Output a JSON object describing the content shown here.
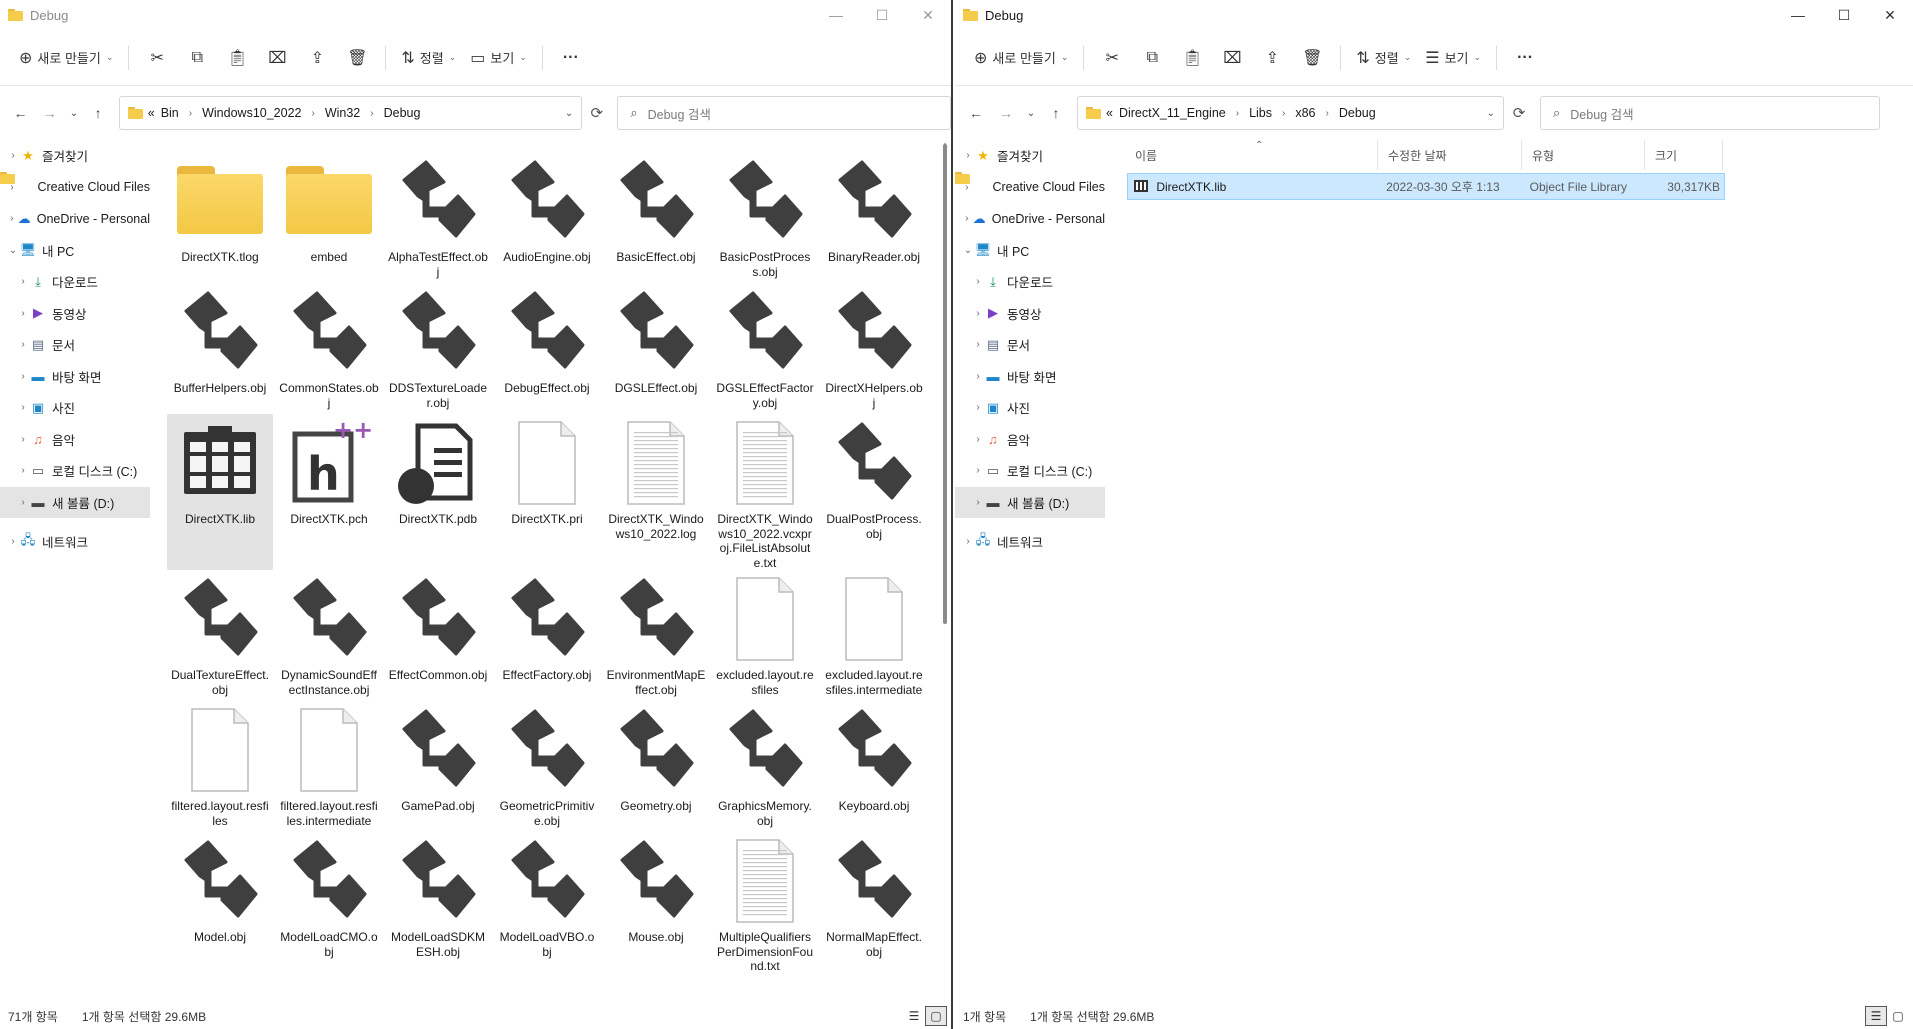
{
  "left_window": {
    "title": "Debug",
    "controls": {
      "minimize": "—",
      "maximize": "☐",
      "close": "✕"
    },
    "toolbar": {
      "new_label": "새로 만들기",
      "sort_label": "정렬",
      "view_label": "보기",
      "more_label": "···"
    },
    "address": {
      "overflow": "«",
      "crumbs": [
        "Bin",
        "Windows10_2022",
        "Win32",
        "Debug"
      ]
    },
    "search_placeholder": "Debug 검색",
    "nav": {
      "quick_access": "즐겨찾기",
      "creative_cloud": "Creative Cloud Files",
      "onedrive": "OneDrive - Personal",
      "this_pc": "내 PC",
      "downloads": "다운로드",
      "videos": "동영상",
      "documents": "문서",
      "desktop": "바탕 화면",
      "pictures": "사진",
      "music": "음악",
      "local_disk": "로컬 디스크 (C:)",
      "new_volume": "새 볼륨 (D:)",
      "network": "네트워크"
    },
    "files": [
      {
        "name": "DirectXTK.tlog",
        "icon": "folder-icon"
      },
      {
        "name": "embed",
        "icon": "folder-icon"
      },
      {
        "name": "AlphaTestEffect.obj",
        "icon": "obj-file-icon"
      },
      {
        "name": "AudioEngine.obj",
        "icon": "obj-file-icon"
      },
      {
        "name": "BasicEffect.obj",
        "icon": "obj-file-icon"
      },
      {
        "name": "BasicPostProcess.obj",
        "icon": "obj-file-icon"
      },
      {
        "name": "BinaryReader.obj",
        "icon": "obj-file-icon"
      },
      {
        "name": "BufferHelpers.obj",
        "icon": "obj-file-icon"
      },
      {
        "name": "CommonStates.obj",
        "icon": "obj-file-icon"
      },
      {
        "name": "DDSTextureLoader.obj",
        "icon": "obj-file-icon"
      },
      {
        "name": "DebugEffect.obj",
        "icon": "obj-file-icon"
      },
      {
        "name": "DGSLEffect.obj",
        "icon": "obj-file-icon"
      },
      {
        "name": "DGSLEffectFactory.obj",
        "icon": "obj-file-icon"
      },
      {
        "name": "DirectXHelpers.obj",
        "icon": "obj-file-icon"
      },
      {
        "name": "DirectXTK.lib",
        "icon": "lib-file-icon",
        "selected": true
      },
      {
        "name": "DirectXTK.pch",
        "icon": "pch-file-icon"
      },
      {
        "name": "DirectXTK.pdb",
        "icon": "pdb-file-icon"
      },
      {
        "name": "DirectXTK.pri",
        "icon": "blank-file-icon"
      },
      {
        "name": "DirectXTK_Windows10_2022.log",
        "icon": "text-file-icon"
      },
      {
        "name": "DirectXTK_Windows10_2022.vcxproj.FileListAbsolute.txt",
        "icon": "text-file-icon"
      },
      {
        "name": "DualPostProcess.obj",
        "icon": "obj-file-icon"
      },
      {
        "name": "DualTextureEffect.obj",
        "icon": "obj-file-icon"
      },
      {
        "name": "DynamicSoundEffectInstance.obj",
        "icon": "obj-file-icon"
      },
      {
        "name": "EffectCommon.obj",
        "icon": "obj-file-icon"
      },
      {
        "name": "EffectFactory.obj",
        "icon": "obj-file-icon"
      },
      {
        "name": "EnvironmentMapEffect.obj",
        "icon": "obj-file-icon"
      },
      {
        "name": "excluded.layout.resfiles",
        "icon": "blank-file-icon"
      },
      {
        "name": "excluded.layout.resfiles.intermediate",
        "icon": "blank-file-icon"
      },
      {
        "name": "filtered.layout.resfiles",
        "icon": "blank-file-icon"
      },
      {
        "name": "filtered.layout.resfiles.intermediate",
        "icon": "blank-file-icon"
      },
      {
        "name": "GamePad.obj",
        "icon": "obj-file-icon"
      },
      {
        "name": "GeometricPrimitive.obj",
        "icon": "obj-file-icon"
      },
      {
        "name": "Geometry.obj",
        "icon": "obj-file-icon"
      },
      {
        "name": "GraphicsMemory.obj",
        "icon": "obj-file-icon"
      },
      {
        "name": "Keyboard.obj",
        "icon": "obj-file-icon"
      },
      {
        "name": "Model.obj",
        "icon": "obj-file-icon"
      },
      {
        "name": "ModelLoadCMO.obj",
        "icon": "obj-file-icon"
      },
      {
        "name": "ModelLoadSDKMESH.obj",
        "icon": "obj-file-icon"
      },
      {
        "name": "ModelLoadVBO.obj",
        "icon": "obj-file-icon"
      },
      {
        "name": "Mouse.obj",
        "icon": "obj-file-icon"
      },
      {
        "name": "MultipleQualifiersPerDimensionFound.txt",
        "icon": "text-file-icon"
      },
      {
        "name": "NormalMapEffect.obj",
        "icon": "obj-file-icon"
      }
    ],
    "status": {
      "count": "71개 항목",
      "selection": "1개 항목 선택함 29.6MB"
    }
  },
  "right_window": {
    "title": "Debug",
    "controls": {
      "minimize": "—",
      "maximize": "☐",
      "close": "✕"
    },
    "toolbar": {
      "new_label": "새로 만들기",
      "sort_label": "정렬",
      "view_label": "보기",
      "more_label": "···"
    },
    "address": {
      "overflow": "«",
      "crumbs": [
        "DirectX_11_Engine",
        "Libs",
        "x86",
        "Debug"
      ]
    },
    "search_placeholder": "Debug 검색",
    "nav": {
      "quick_access": "즐겨찾기",
      "creative_cloud": "Creative Cloud Files",
      "onedrive": "OneDrive - Personal",
      "this_pc": "내 PC",
      "downloads": "다운로드",
      "videos": "동영상",
      "documents": "문서",
      "desktop": "바탕 화면",
      "pictures": "사진",
      "music": "음악",
      "local_disk": "로컬 디스크 (C:)",
      "new_volume": "새 볼륨 (D:)",
      "network": "네트워크"
    },
    "columns": {
      "name": "이름",
      "date": "수정한 날짜",
      "type": "유형",
      "size": "크기"
    },
    "rows": [
      {
        "name": "DirectXTK.lib",
        "date": "2022-03-30 오후 1:13",
        "type": "Object File Library",
        "size": "30,317KB"
      }
    ],
    "status": {
      "count": "1개 항목",
      "selection": "1개 항목 선택함 29.6MB"
    }
  },
  "colors": {
    "folder": "#f6cc4b",
    "selection": "#cce8ff",
    "nav_selected": "#e4e4e4"
  }
}
